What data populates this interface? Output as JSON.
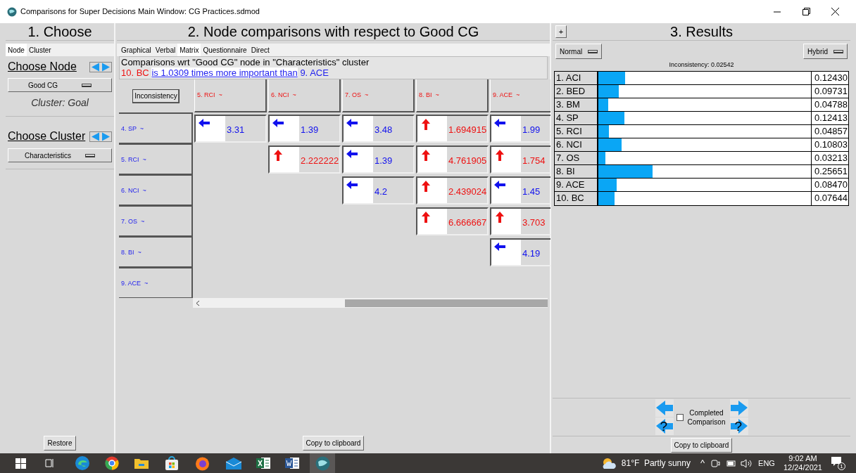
{
  "window": {
    "title": "Comparisons for Super Decisions Main Window: CG Practices.sdmod"
  },
  "choose": {
    "header": "1. Choose",
    "tabs": [
      {
        "label": "Node",
        "selected": true
      },
      {
        "label": "Cluster",
        "selected": false
      }
    ],
    "node_heading": "Choose Node",
    "node_value": "Good CG",
    "cluster_note": "Cluster: Goal",
    "cluster_heading": "Choose Cluster",
    "cluster_value": "Characteristics",
    "restore": "Restore"
  },
  "comparisons": {
    "header": "2. Node comparisons with respect to Good CG",
    "tabs": [
      {
        "label": "Graphical",
        "selected": false
      },
      {
        "label": "Verbal",
        "selected": false
      },
      {
        "label": "Matrix",
        "selected": true
      },
      {
        "label": "Questionnaire",
        "selected": false
      },
      {
        "label": "Direct",
        "selected": false
      }
    ],
    "description": "Comparisons wrt \"Good CG\" node in \"Characteristics\" cluster",
    "statement": {
      "left_node": "10. BC",
      "phrase": "is 1.0309 times more important than",
      "right_node": "9. ACE"
    },
    "inconsistency_button": "Inconsistency",
    "columns": [
      "5. RCI  ~",
      "6. NCI  ~",
      "7. OS  ~",
      "8. BI  ~",
      "9. ACE  ~"
    ],
    "rows": [
      {
        "label": "4. SP  ~",
        "cells": [
          {
            "kind": "left",
            "value": "3.31"
          },
          {
            "kind": "left",
            "value": "1.39"
          },
          {
            "kind": "left",
            "value": "3.48"
          },
          {
            "kind": "up",
            "value": "1.694915"
          },
          {
            "kind": "left",
            "value": "1.99"
          }
        ]
      },
      {
        "label": "5. RCI  ~",
        "cells": [
          {
            "kind": "empty"
          },
          {
            "kind": "up",
            "value": "2.222222"
          },
          {
            "kind": "left",
            "value": "1.39"
          },
          {
            "kind": "up",
            "value": "4.761905"
          },
          {
            "kind": "up",
            "value": "1.754"
          }
        ]
      },
      {
        "label": "6. NCI  ~",
        "cells": [
          {
            "kind": "empty"
          },
          {
            "kind": "empty"
          },
          {
            "kind": "left",
            "value": "4.2"
          },
          {
            "kind": "up",
            "value": "2.439024"
          },
          {
            "kind": "left",
            "value": "1.45"
          }
        ]
      },
      {
        "label": "7. OS  ~",
        "cells": [
          {
            "kind": "empty"
          },
          {
            "kind": "empty"
          },
          {
            "kind": "empty"
          },
          {
            "kind": "up",
            "value": "6.666667"
          },
          {
            "kind": "up",
            "value": "3.703"
          }
        ]
      },
      {
        "label": "8. BI  ~",
        "cells": [
          {
            "kind": "empty"
          },
          {
            "kind": "empty"
          },
          {
            "kind": "empty"
          },
          {
            "kind": "empty"
          },
          {
            "kind": "left",
            "value": "4.19"
          }
        ]
      },
      {
        "label": "9. ACE  ~",
        "cells": [
          {
            "kind": "empty"
          },
          {
            "kind": "empty"
          },
          {
            "kind": "empty"
          },
          {
            "kind": "empty"
          },
          {
            "kind": "empty"
          }
        ]
      }
    ],
    "copy": "Copy to clipboard"
  },
  "results": {
    "expand": "+",
    "header": "3. Results",
    "mode": "Normal",
    "method": "Hybrid",
    "inconsistency": "Inconsistency: 0.02542",
    "rows": [
      {
        "label": "1. ACI",
        "level": 0.1243,
        "value": "0.12430"
      },
      {
        "label": "2. BED",
        "level": 0.09731,
        "value": "0.09731"
      },
      {
        "label": "3. BM",
        "level": 0.04788,
        "value": "0.04788"
      },
      {
        "label": "4. SP",
        "level": 0.12413,
        "value": "0.12413"
      },
      {
        "label": "5. RCI",
        "level": 0.04857,
        "value": "0.04857"
      },
      {
        "label": "6. NCI",
        "level": 0.10803,
        "value": "0.10803"
      },
      {
        "label": "7. OS",
        "level": 0.03213,
        "value": "0.03213"
      },
      {
        "label": "8. BI",
        "level": 0.25651,
        "value": "0.25651"
      },
      {
        "label": "9. ACE",
        "level": 0.0847,
        "value": "0.08470"
      },
      {
        "label": "10. BC",
        "level": 0.07644,
        "value": "0.07644"
      }
    ],
    "completed": {
      "label": "Completed Comparison",
      "checked": false
    },
    "question_mark_left": "?",
    "question_mark_right": "?",
    "copy": "Copy to clipboard"
  },
  "taskbar": {
    "weather": "81°F  Partly sunny",
    "caret": "^",
    "language": "ENG",
    "time": "9:02 AM",
    "date": "12/24/2021",
    "notifications": "1"
  }
}
